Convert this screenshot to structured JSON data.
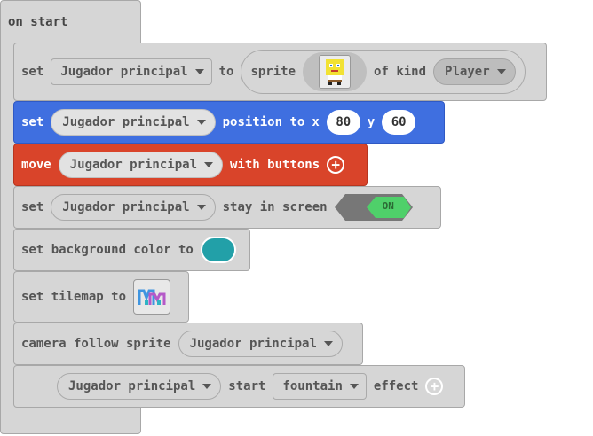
{
  "hat": {
    "label": "on start"
  },
  "blocks": {
    "set_sprite": {
      "set": "set",
      "variable": "Jugador principal",
      "to": "to",
      "sprite": "sprite",
      "of_kind": "of kind",
      "kind": "Player"
    },
    "position": {
      "set": "set",
      "variable": "Jugador principal",
      "position_to": "position to",
      "x_label": "x",
      "x_value": "80",
      "y_label": "y",
      "y_value": "60"
    },
    "move": {
      "move": "move",
      "variable": "Jugador principal",
      "with_buttons": "with buttons"
    },
    "stay": {
      "set": "set",
      "variable": "Jugador principal",
      "stay_in_screen": "stay in screen",
      "toggle": "ON"
    },
    "background": {
      "label": "set background color to",
      "color": "#22a0a8"
    },
    "tilemap": {
      "label": "set tilemap to"
    },
    "camera": {
      "label": "camera follow sprite",
      "variable": "Jugador principal"
    },
    "effect": {
      "variable": "Jugador principal",
      "start": "start",
      "effect_name": "fountain",
      "effect": "effect"
    }
  },
  "colors": {
    "gray_block": "#d6d6d6",
    "blue_block": "#3f6fe0",
    "red_block": "#d9442a",
    "toggle_green": "#4fd06a",
    "toggle_gray": "#777777"
  }
}
